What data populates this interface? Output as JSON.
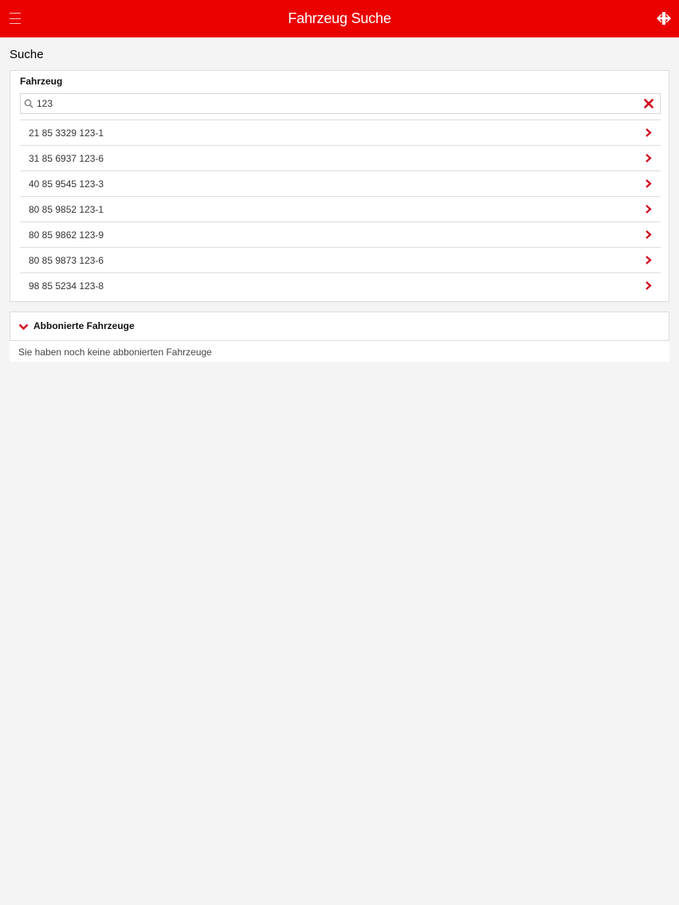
{
  "header": {
    "title": "Fahrzeug Suche",
    "menu_icon": "hamburger-menu-icon",
    "logo_icon": "sbb-logo-icon",
    "color": "#eb0000"
  },
  "search_section": {
    "title": "Suche",
    "field_label": "Fahrzeug",
    "input_value": "123",
    "search_icon": "search-icon",
    "clear_icon": "clear-x-icon"
  },
  "results": [
    "21 85 3329 123-1",
    "31 85 6937 123-6",
    "40 85 9545 123-3",
    "80 85 9852 123-1",
    "80 85 9862 123-9",
    "80 85 9873 123-6",
    "98 85 5234 123-8"
  ],
  "subscribed": {
    "title": "Abbonierte Fahrzeuge",
    "empty_message": "Sie haben noch keine abbonierten Fahrzeuge",
    "icon": "chevron-down-icon"
  },
  "accent_color": "#d0021b"
}
